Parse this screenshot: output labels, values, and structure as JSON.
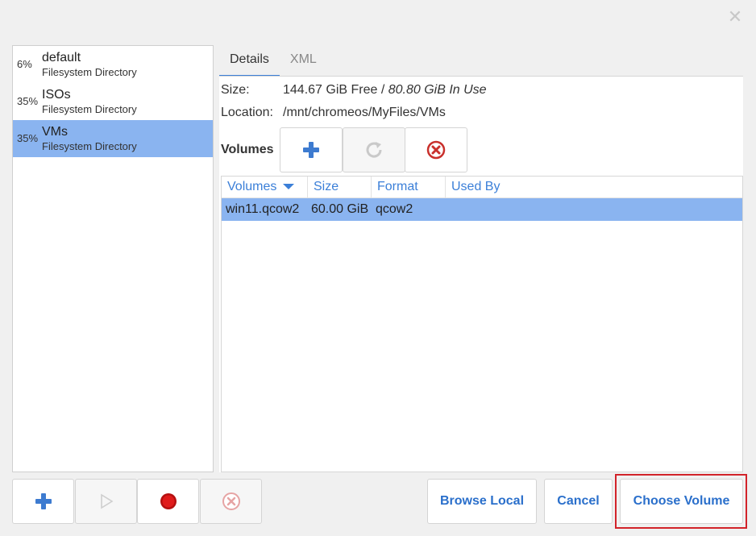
{
  "pools": [
    {
      "percent": "6%",
      "name": "default",
      "type": "Filesystem Directory",
      "selected": false
    },
    {
      "percent": "35%",
      "name": "ISOs",
      "type": "Filesystem Directory",
      "selected": false
    },
    {
      "percent": "35%",
      "name": "VMs",
      "type": "Filesystem Directory",
      "selected": true
    }
  ],
  "tabs": {
    "details": "Details",
    "xml": "XML"
  },
  "details": {
    "size_label": "Size:",
    "size_free": "144.67 GiB Free / ",
    "size_inuse": "80.80 GiB In Use",
    "location_label": "Location:",
    "location_value": "/mnt/chromeos/MyFiles/VMs",
    "volumes_label": "Volumes"
  },
  "table": {
    "columns": [
      "Volumes",
      "Size",
      "Format",
      "Used By"
    ],
    "rows": [
      {
        "name": "win11.qcow2",
        "size": "60.00 GiB",
        "format": "qcow2",
        "used_by": ""
      }
    ]
  },
  "actions": {
    "browse_local": "Browse Local",
    "cancel": "Cancel",
    "choose_volume": "Choose Volume"
  },
  "colors": {
    "accent": "#3b7fd8",
    "selection": "#8ab4f0",
    "highlight": "#d2232a"
  }
}
